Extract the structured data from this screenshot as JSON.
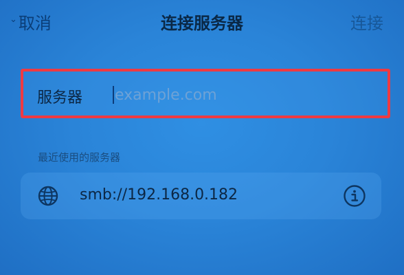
{
  "nav": {
    "cancel_label": "取消",
    "title": "连接服务器",
    "connect_label": "连接"
  },
  "server_field": {
    "label": "服务器",
    "placeholder": "example.com",
    "value": ""
  },
  "recent": {
    "header": "最近使用的服务器",
    "items": [
      {
        "address": "smb://192.168.0.182",
        "icon": "globe-icon",
        "action_icon": "info-icon"
      }
    ]
  },
  "colors": {
    "highlight_border": "#ee3a42",
    "background": "#2a84d8",
    "text": "#0c2744"
  }
}
